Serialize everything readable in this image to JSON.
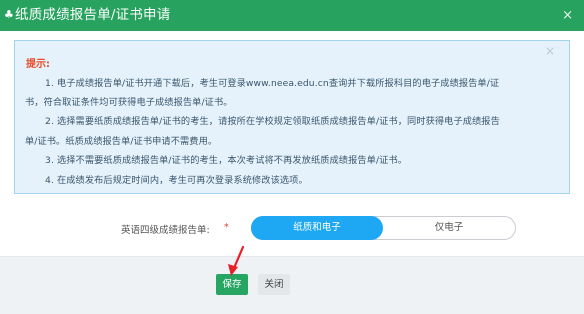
{
  "dialog": {
    "title_icon": "♣",
    "title": "纸质成绩报告单/证书申请",
    "close_glyph": "×"
  },
  "notice": {
    "close_glyph": "×",
    "heading": "提示:",
    "lines": [
      "1. 电子成绩报告单/证书开通下载后，考生可登录www.neea.edu.cn查询并下载所报科目的电子成绩报告单/证",
      "书，符合取证条件均可获得电子成绩报告单/证书。",
      "2. 选择需要纸质成绩报告单/证书的考生，请按所在学校规定领取纸质成绩报告单/证书，同时获得电子成绩报告",
      "单/证书。纸质成绩报告单/证书申请不需费用。",
      "3. 选择不需要纸质成绩报告单/证书的考生，本次考试将不再发放纸质成绩报告单/证书。",
      "4. 在成绩发布后规定时间内，考生可再次登录系统修改该选项。"
    ]
  },
  "form": {
    "label": "英语四级成绩报告单:",
    "required_mark": "*",
    "options": [
      "纸质和电子",
      "仅电子"
    ],
    "selected": "纸质和电子"
  },
  "footer": {
    "save_label": "保存",
    "close_label": "关闭"
  },
  "colors": {
    "title_bar": "#27a35f",
    "notice_bg": "#e6f2fb",
    "notice_heading": "#ea4c2a",
    "toggle_selected": "#1ea7f2",
    "save_button": "#26a563",
    "annotation_arrow": "#e8202a"
  },
  "icons": {
    "title": "club-icon",
    "close": "close-icon",
    "annotation": "red-arrow-icon"
  }
}
